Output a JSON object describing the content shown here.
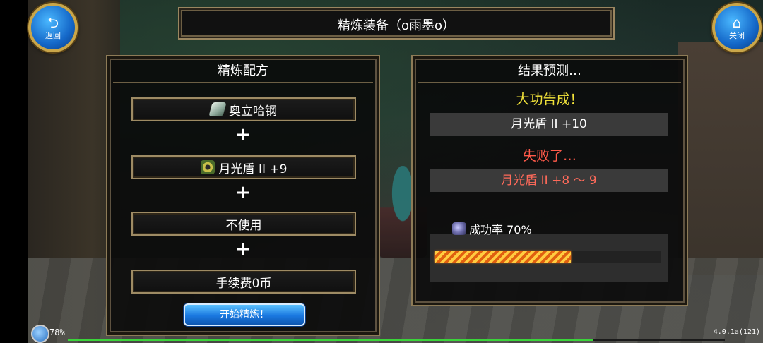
{
  "title": "精炼装备（o雨墨o）",
  "buttons": {
    "back_label": "返回",
    "close_label": "关闭",
    "start_label": "开始精炼！"
  },
  "recipe": {
    "header": "精炼配方",
    "slot1": "奥立哈钢",
    "slot2": "月光盾 II  +9",
    "slot3": "不使用",
    "fee": "手续费0币",
    "plus": "+"
  },
  "prediction": {
    "header": "结果预测…",
    "success_label": "大功告成！",
    "success_item": "月光盾 II  +10",
    "fail_label": "失败了…",
    "fail_item": "月光盾 II  +8  ～  9",
    "rate_text": "成功率  70%",
    "rate_value": 0.6
  },
  "status": {
    "battery": "78%",
    "version": "4.0.1a(121)",
    "progress": 0.8
  },
  "icons": {
    "back": "back-arrow-icon",
    "close": "home-icon",
    "ore": "ingot-icon",
    "shield": "shield-icon",
    "rate": "rate-icon"
  },
  "colors": {
    "success": "#f2e23a",
    "fail": "#ff5a4a",
    "button": "#1a78e0"
  }
}
